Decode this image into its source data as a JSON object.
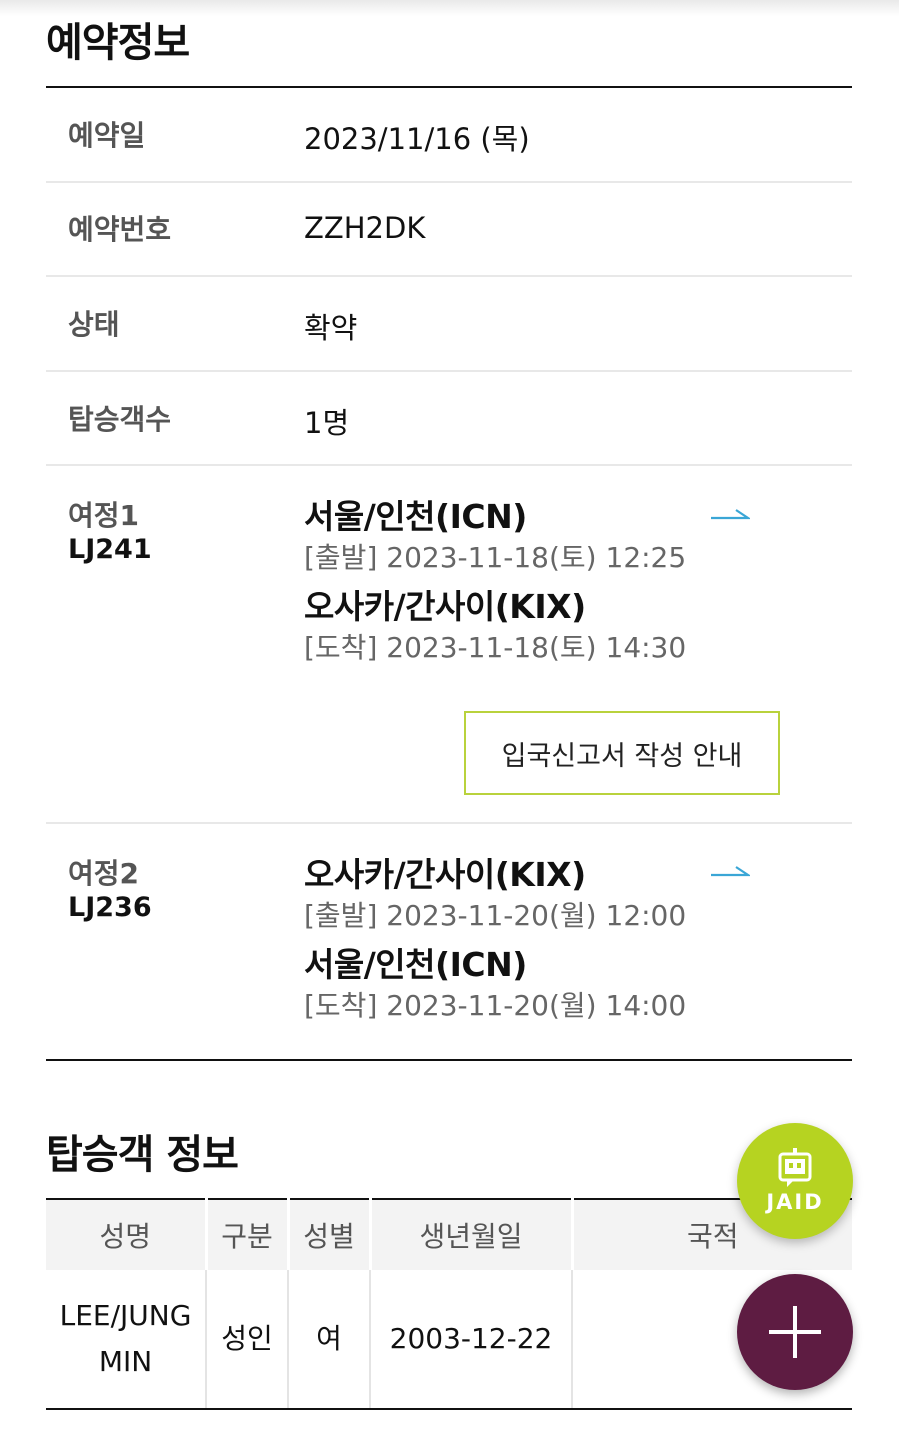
{
  "reservation": {
    "title": "예약정보",
    "rows": [
      {
        "label": "예약일",
        "value": "2023/11/16 (목)"
      },
      {
        "label": "예약번호",
        "value": "ZZH2DK"
      },
      {
        "label": "상태",
        "value": "확약"
      },
      {
        "label": "탑승객수",
        "value": "1명"
      }
    ],
    "itineraries": [
      {
        "label": "여정1",
        "flight": "LJ241",
        "origin": "서울/인천(ICN)",
        "depart": "[출발] 2023-11-18(토) 12:25",
        "destination": "오사카/간사이(KIX)",
        "arrive": "[도착] 2023-11-18(토) 14:30",
        "guide_button": "입국신고서 작성 안내"
      },
      {
        "label": "여정2",
        "flight": "LJ236",
        "origin": "오사카/간사이(KIX)",
        "depart": "[출발] 2023-11-20(월) 12:00",
        "destination": "서울/인천(ICN)",
        "arrive": "[도착] 2023-11-20(월) 14:00"
      }
    ]
  },
  "passengers": {
    "title": "탑승객 정보",
    "columns": [
      "성명",
      "구분",
      "성별",
      "생년월일",
      "국적"
    ],
    "rows": [
      {
        "name_line1": "LEE/JUNG",
        "name_line2": "MIN",
        "type": "성인",
        "gender": "여",
        "birth": "2003-12-22",
        "nationality": ""
      }
    ]
  },
  "fab": {
    "jaid_label": "JAID",
    "jaid_color": "#b6d321",
    "plus_color": "#5e1c42"
  },
  "colors": {
    "accent_border": "#b9d23c",
    "arrow": "#3aa6d6"
  },
  "icons": [
    "right-arrow-icon",
    "chat-bot-icon",
    "plus-icon"
  ]
}
